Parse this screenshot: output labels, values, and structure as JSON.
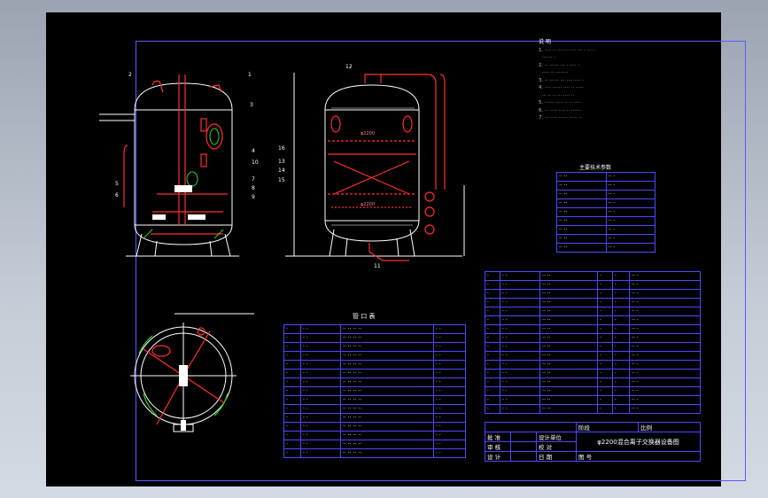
{
  "drawing": {
    "title_block": {
      "project_name": "φ2200混合离子交换器设备图",
      "rows": [
        [
          "批 准",
          "设计单位"
        ],
        [
          "审 核",
          "校 对"
        ],
        [
          "设 计",
          "日 期"
        ]
      ],
      "stage_label": "阶段",
      "scale_label": "比例",
      "drawing_no_label": "图 号"
    },
    "nozzle_table": {
      "title": "管 口 表"
    },
    "tech_table": {
      "title": "主要技术参数"
    },
    "notes_title": "说 明",
    "dimension_labels": {
      "width": "φ2200",
      "lower_dia": "φ2200"
    },
    "part_balloons": [
      "1",
      "2",
      "3",
      "4",
      "5",
      "6",
      "7",
      "8",
      "9",
      "10",
      "11",
      "12",
      "13",
      "14",
      "15",
      "16"
    ],
    "colors": {
      "outline": "#ffffff",
      "red": "#ff3030",
      "green": "#30d030",
      "frame": "#5a5aff",
      "background": "#000000"
    }
  }
}
